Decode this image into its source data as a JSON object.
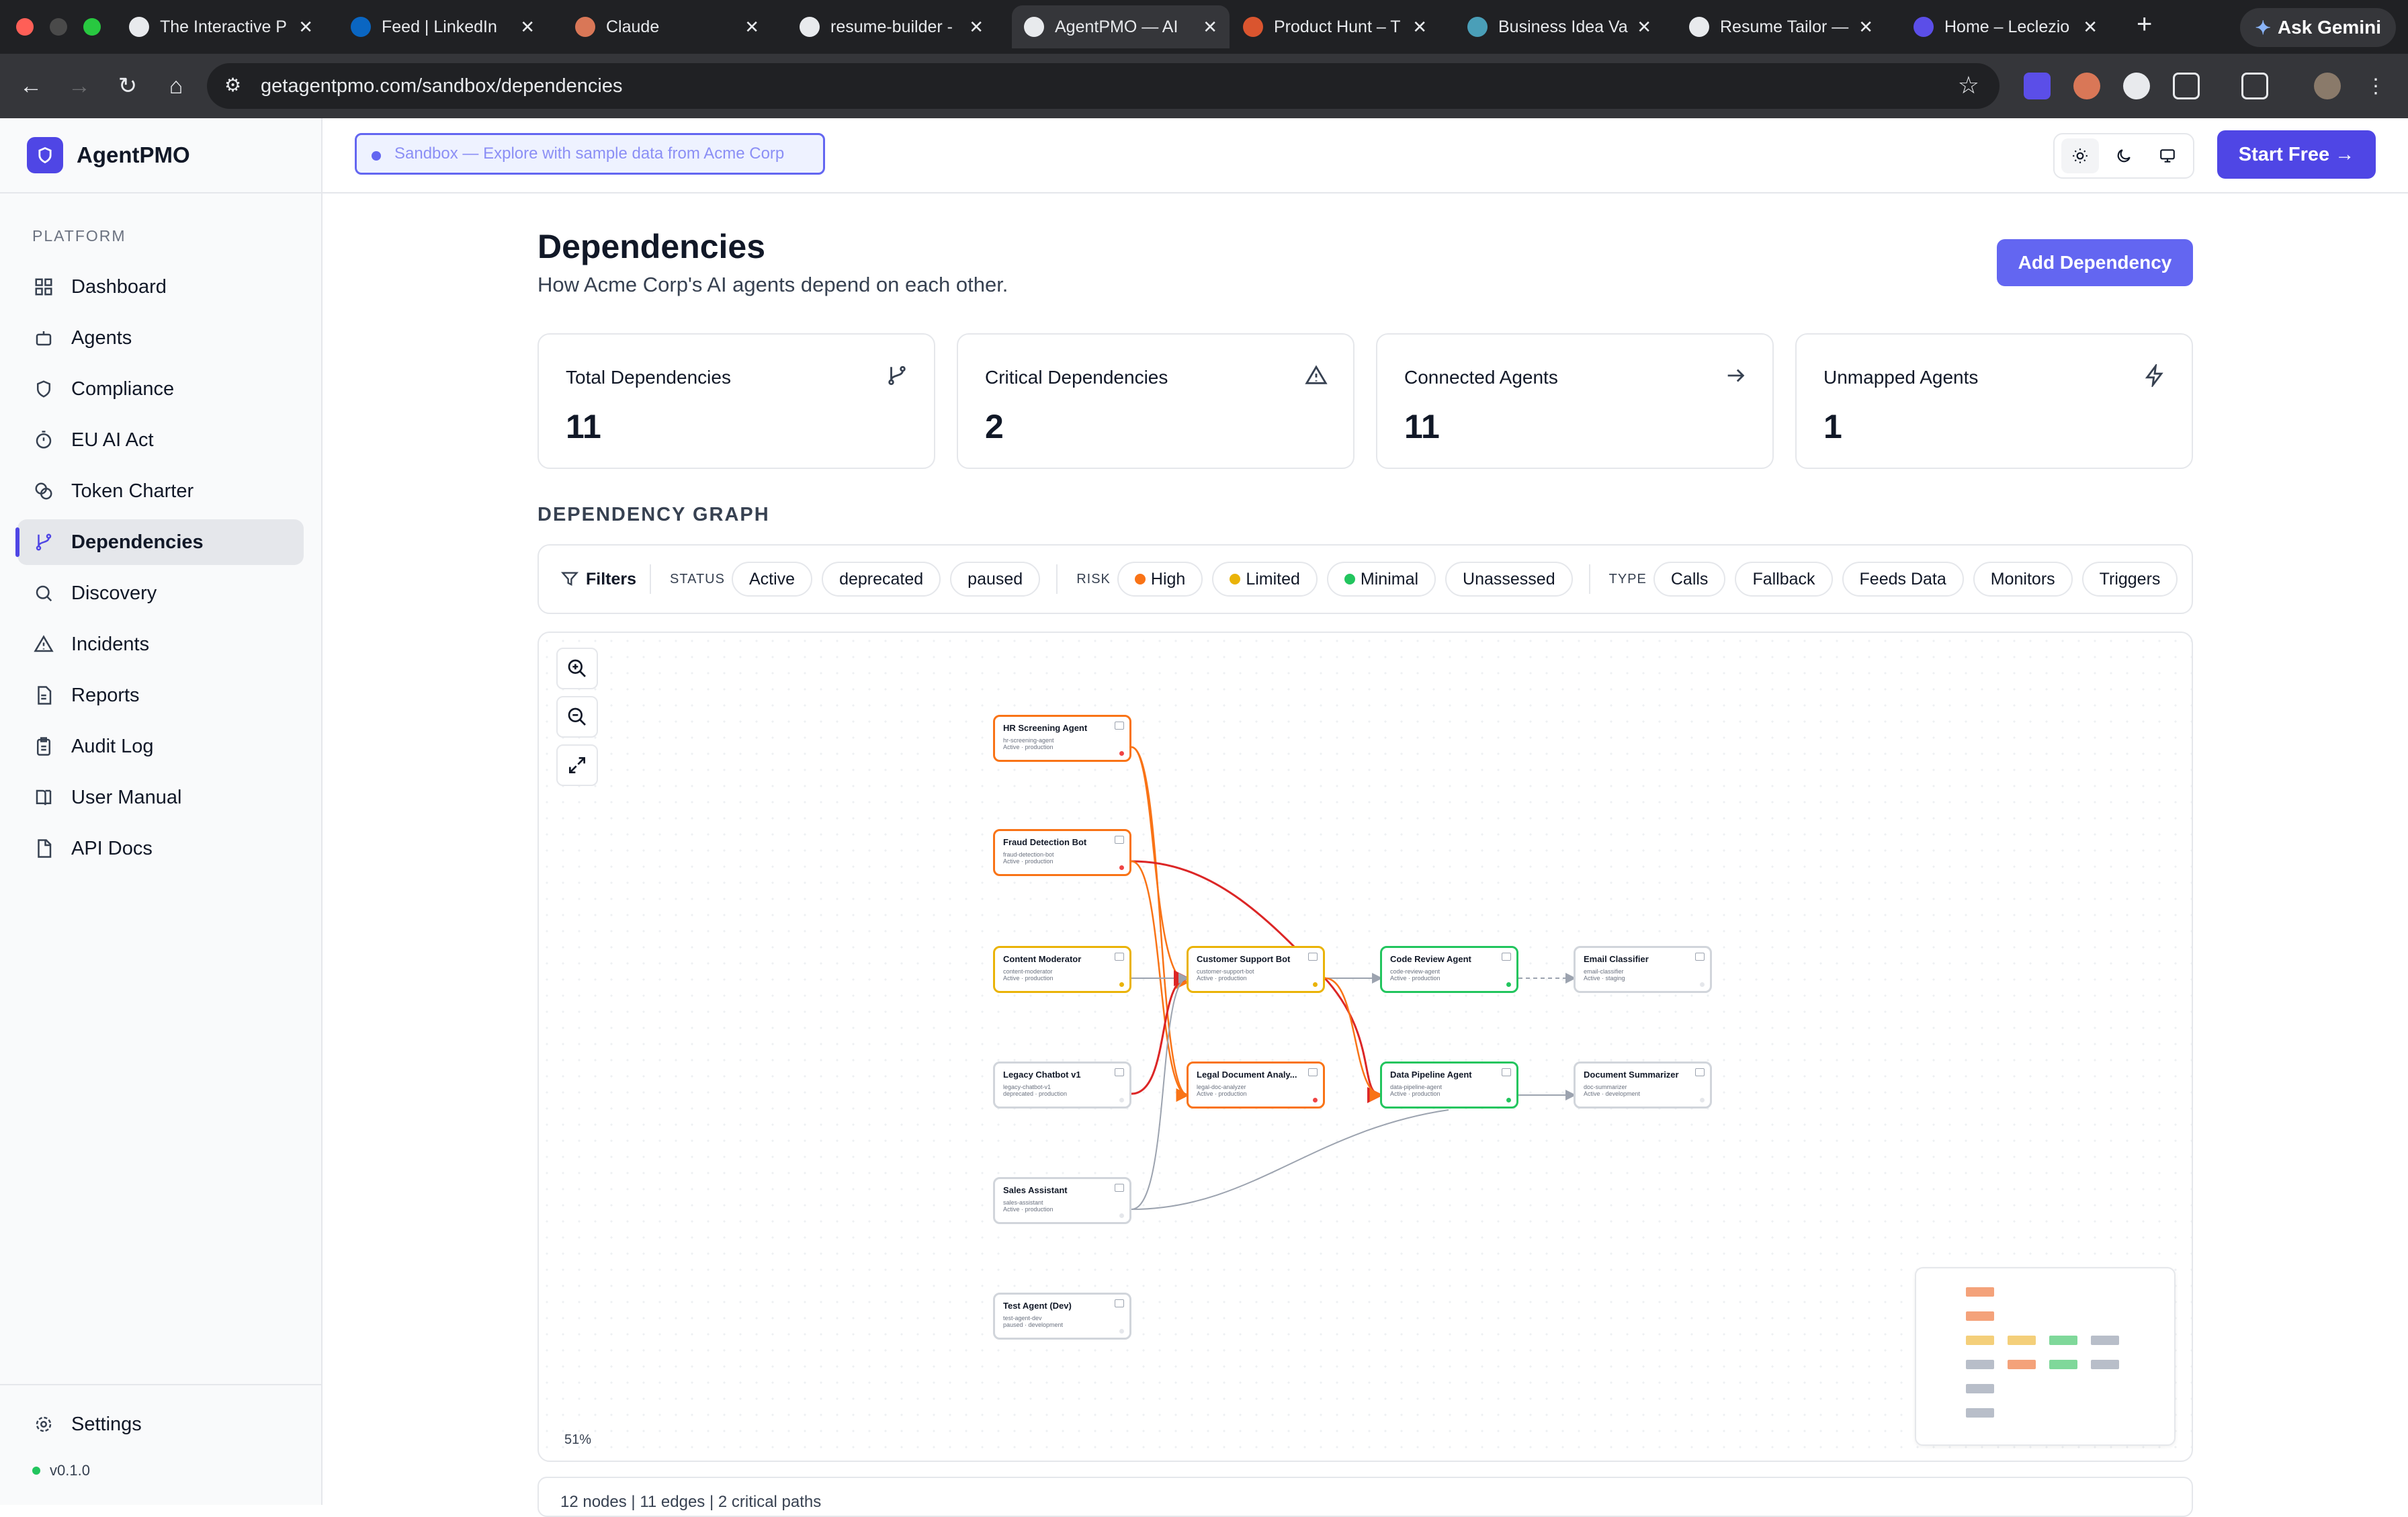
{
  "browser": {
    "tabs": [
      {
        "title": "The Interactive P",
        "favicon_color": "#e8eaed"
      },
      {
        "title": "Feed | LinkedIn",
        "favicon_color": "#0a66c2"
      },
      {
        "title": "Claude",
        "favicon_color": "#d97757"
      },
      {
        "title": "resume-builder -",
        "favicon_color": "#e8eaed"
      },
      {
        "title": "AgentPMO — AI",
        "favicon_color": "#e8eaed"
      },
      {
        "title": "Product Hunt – T",
        "favicon_color": "#da552f"
      },
      {
        "title": "Business Idea Va",
        "favicon_color": "#4a9fb8"
      },
      {
        "title": "Resume Tailor —",
        "favicon_color": "#e8eaed"
      },
      {
        "title": "Home – Leclezio",
        "favicon_color": "#5b4ee8"
      }
    ],
    "url": "getagentpmo.com/sandbox/dependencies",
    "gemini_label": "Ask Gemini"
  },
  "app": {
    "name": "AgentPMO",
    "accent": "#4f46e5",
    "sandbox_banner": "Sandbox — Explore with sample data from Acme Corp",
    "start_free": "Start Free →",
    "version": "v0.1.0"
  },
  "sidebar": {
    "section": "PLATFORM",
    "items": [
      {
        "label": "Dashboard",
        "icon": "grid-icon"
      },
      {
        "label": "Agents",
        "icon": "bot-icon"
      },
      {
        "label": "Compliance",
        "icon": "shield-icon"
      },
      {
        "label": "EU AI Act",
        "icon": "timer-icon"
      },
      {
        "label": "Token Charter",
        "icon": "coins-icon"
      },
      {
        "label": "Dependencies",
        "icon": "branch-icon",
        "active": true
      },
      {
        "label": "Discovery",
        "icon": "search-icon"
      },
      {
        "label": "Incidents",
        "icon": "alert-icon"
      },
      {
        "label": "Reports",
        "icon": "file-icon"
      },
      {
        "label": "Audit Log",
        "icon": "clipboard-icon"
      },
      {
        "label": "User Manual",
        "icon": "book-icon"
      },
      {
        "label": "API Docs",
        "icon": "doc-icon"
      }
    ],
    "settings": "Settings"
  },
  "page": {
    "title": "Dependencies",
    "subtitle": "How Acme Corp's AI agents depend on each other.",
    "add_button": "Add Dependency"
  },
  "stats": [
    {
      "label": "Total Dependencies",
      "value": "11",
      "icon": "branch-icon"
    },
    {
      "label": "Critical Dependencies",
      "value": "2",
      "icon": "alert-icon"
    },
    {
      "label": "Connected Agents",
      "value": "11",
      "icon": "arrow-right-icon"
    },
    {
      "label": "Unmapped Agents",
      "value": "1",
      "icon": "zap-icon"
    }
  ],
  "graph": {
    "section_title": "DEPENDENCY GRAPH",
    "filters_label": "Filters",
    "status_label": "STATUS",
    "status_options": [
      "Active",
      "deprecated",
      "paused"
    ],
    "risk_label": "RISK",
    "risk_options": [
      {
        "label": "High",
        "color": "#f97316"
      },
      {
        "label": "Limited",
        "color": "#eab308"
      },
      {
        "label": "Minimal",
        "color": "#22c55e"
      },
      {
        "label": "Unassessed",
        "color": ""
      }
    ],
    "type_label": "TYPE",
    "type_options": [
      "Calls",
      "Fallback",
      "Feeds Data",
      "Monitors",
      "Triggers"
    ],
    "zoom": "51%",
    "nodes": [
      {
        "name": "HR Screening Agent",
        "slug": "hr-screening-agent",
        "meta": "Active · production",
        "risk": "high"
      },
      {
        "name": "Fraud Detection Bot",
        "slug": "fraud-detection-bot",
        "meta": "Active · production",
        "risk": "high"
      },
      {
        "name": "Content Moderator",
        "slug": "content-moderator",
        "meta": "Active · production",
        "risk": "limited"
      },
      {
        "name": "Legacy Chatbot v1",
        "slug": "legacy-chatbot-v1",
        "meta": "deprecated · production",
        "risk": "none"
      },
      {
        "name": "Sales Assistant",
        "slug": "sales-assistant",
        "meta": "Active · production",
        "risk": "none"
      },
      {
        "name": "Test Agent (Dev)",
        "slug": "test-agent-dev",
        "meta": "paused · development",
        "risk": "none"
      },
      {
        "name": "Customer Support Bot",
        "slug": "customer-support-bot",
        "meta": "Active · production",
        "risk": "limited"
      },
      {
        "name": "Legal Document Analy...",
        "slug": "legal-doc-analyzer",
        "meta": "Active · production",
        "risk": "high"
      },
      {
        "name": "Code Review Agent",
        "slug": "code-review-agent",
        "meta": "Active · production",
        "risk": "minimal"
      },
      {
        "name": "Data Pipeline Agent",
        "slug": "data-pipeline-agent",
        "meta": "Active · production",
        "risk": "minimal"
      },
      {
        "name": "Email Classifier",
        "slug": "email-classifier",
        "meta": "Active · staging",
        "risk": "none"
      },
      {
        "name": "Document Summarizer",
        "slug": "doc-summarizer",
        "meta": "Active · development",
        "risk": "none"
      }
    ],
    "risk_colors": {
      "high": "#f97316",
      "limited": "#eab308",
      "minimal": "#22c55e",
      "none": "#d1d5db"
    },
    "footer": "12 nodes   |   11 edges   |   2 critical paths"
  }
}
